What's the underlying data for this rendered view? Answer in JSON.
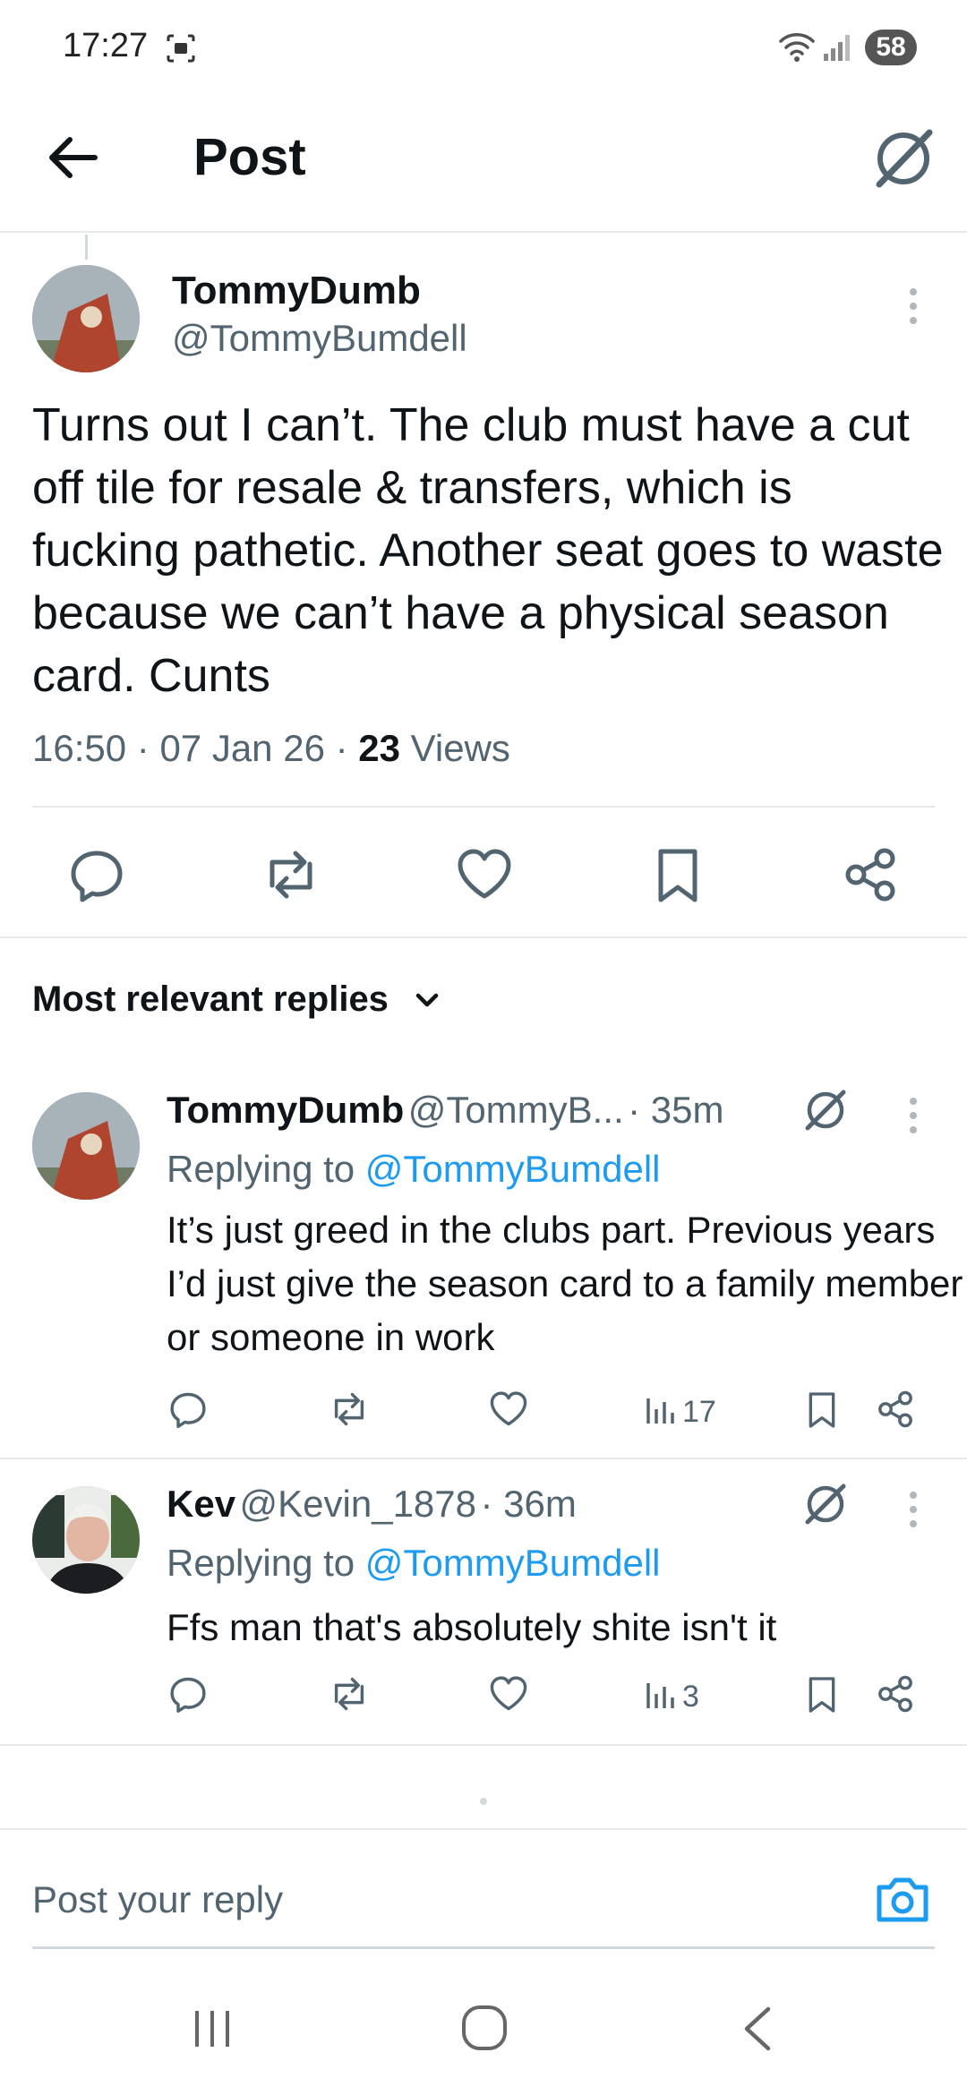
{
  "status_bar": {
    "time": "17:27",
    "battery": "58"
  },
  "header": {
    "title": "Post"
  },
  "post": {
    "author_name": "TommyDumb",
    "author_handle": "@TommyBumdell",
    "text": "Turns out I can’t. The club must have a cut off tile for resale & transfers, which is fucking pathetic. Another seat goes to waste because we can’t have a physical season card. Cunts",
    "time": "16:50",
    "date": "07 Jan 26",
    "views_count": "23",
    "views_label": "Views"
  },
  "replies_section": {
    "label": "Most relevant replies"
  },
  "replies": [
    {
      "name": "TommyDumb",
      "handle": "@TommyB...",
      "age": "35m",
      "replying_prefix": "Replying to",
      "replying_handle": "@TommyBumdell",
      "text": "It’s just greed in the clubs part. Previous years I’d just give the season card to a family member or someone in work",
      "views": "17"
    },
    {
      "name": "Kev",
      "handle": "@Kevin_1878",
      "age": "36m",
      "replying_prefix": "Replying to",
      "replying_handle": "@TommyBumdell",
      "text": "Ffs man that's absolutely shite isn't it",
      "views": "3"
    }
  ],
  "composer": {
    "placeholder": "Post your reply"
  },
  "colors": {
    "accent": "#1d9bf0",
    "text": "#0f1419",
    "muted": "#536471"
  }
}
